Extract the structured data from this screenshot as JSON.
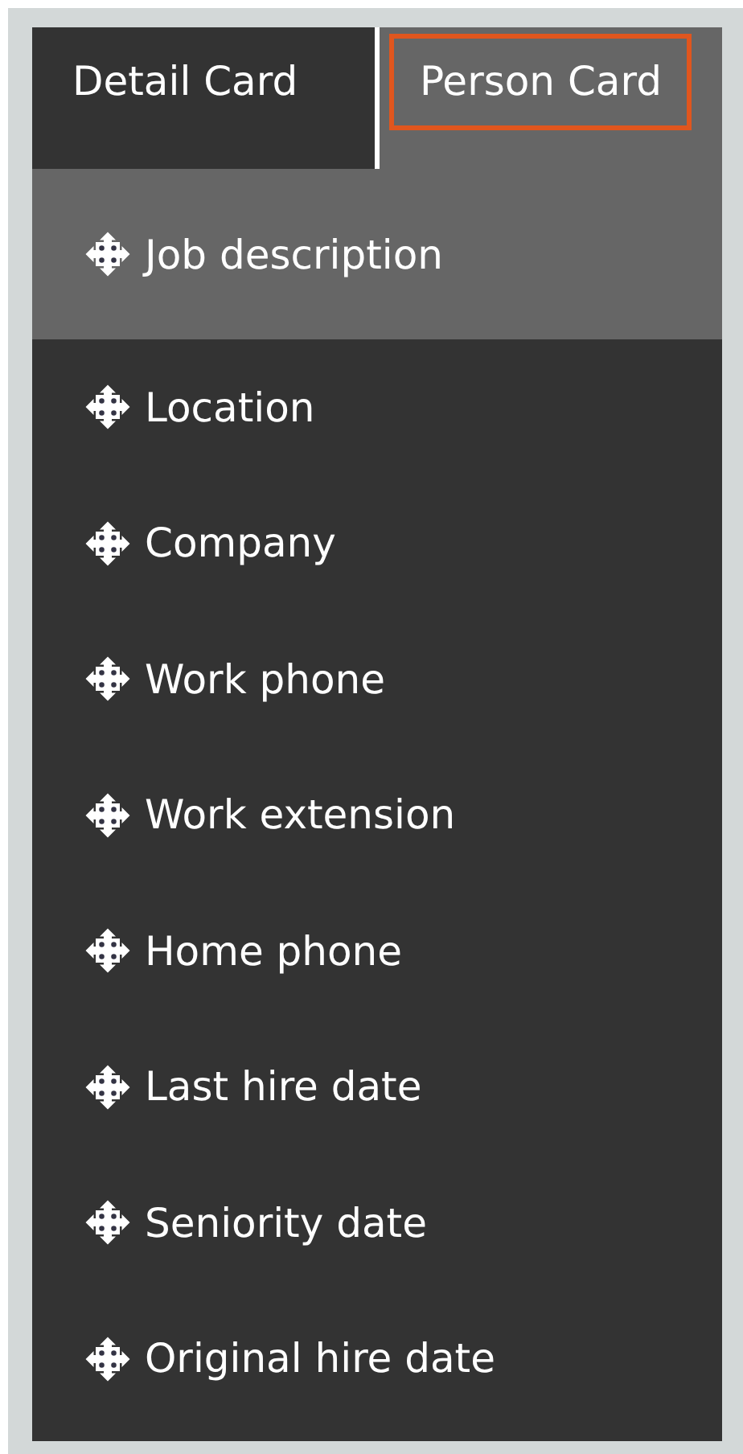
{
  "tabs": [
    {
      "label": "Detail Card",
      "selected": false,
      "focused": false
    },
    {
      "label": "Person Card",
      "selected": true,
      "focused": true
    }
  ],
  "fields": [
    {
      "label": "Job description",
      "selected": true
    },
    {
      "label": "Location",
      "selected": false
    },
    {
      "label": "Company",
      "selected": false
    },
    {
      "label": "Work phone",
      "selected": false
    },
    {
      "label": "Work extension",
      "selected": false
    },
    {
      "label": "Home phone",
      "selected": false
    },
    {
      "label": "Last hire date",
      "selected": false
    },
    {
      "label": "Seniority date",
      "selected": false
    },
    {
      "label": "Original hire date",
      "selected": false
    }
  ]
}
